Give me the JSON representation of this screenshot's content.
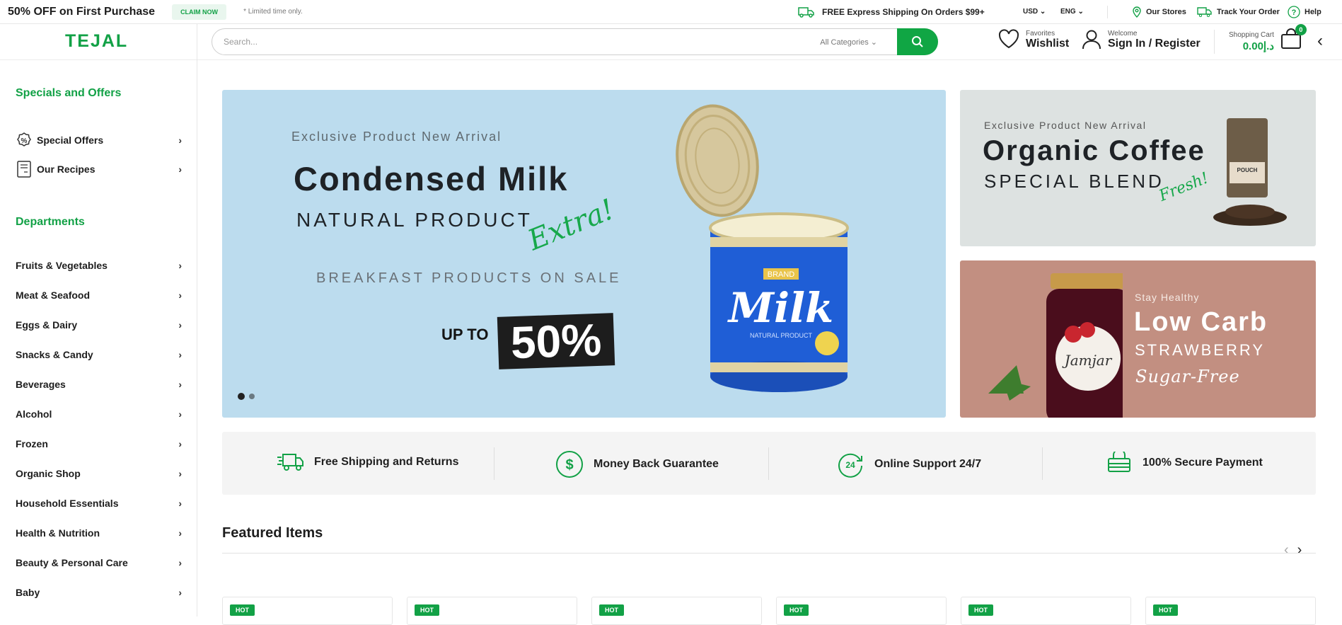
{
  "topbar": {
    "promo": "50% OFF on First Purchase",
    "claim": "CLAIM NOW",
    "limited": "* Limited time only.",
    "shipping": "FREE Express Shipping On Orders $99+",
    "currency": "USD",
    "language": "ENG",
    "stores": "Our Stores",
    "track": "Track Your Order",
    "help": "Help"
  },
  "header": {
    "logo": "TEJAL",
    "search_placeholder": "Search...",
    "categories": "All Categories",
    "favorites_small": "Favorites",
    "favorites_big": "Wishlist",
    "welcome_small": "Welcome",
    "welcome_big": "Sign In / Register",
    "cart_small": "Shopping Cart",
    "cart_total": "0.00د.إ",
    "cart_count": "0"
  },
  "sidebar": {
    "specials_title": "Specials and Offers",
    "specials": [
      "Special Offers",
      "Our Recipes"
    ],
    "departments_title": "Departments",
    "departments": [
      "Fruits & Vegetables",
      "Meat & Seafood",
      "Eggs & Dairy",
      "Snacks & Candy",
      "Beverages",
      "Alcohol",
      "Frozen",
      "Organic Shop",
      "Household Essentials",
      "Health & Nutrition",
      "Beauty & Personal Care",
      "Baby"
    ]
  },
  "banner": {
    "exclusive": "Exclusive Product New Arrival",
    "title": "Condensed Milk",
    "subtitle": "NATURAL PRODUCT",
    "extra": "Extra!",
    "sale": "BREAKFAST PRODUCTS ON SALE",
    "upto": "UP TO",
    "percent": "50%",
    "can_brand": "BRAND",
    "can_label": "Milk",
    "can_sub": "NATURAL PRODUCT"
  },
  "banner_coffee": {
    "exclusive": "Exclusive Product New Arrival",
    "title": "Organic Coffee",
    "subtitle": "SPECIAL BLEND",
    "extra": "Fresh!",
    "pouch": "POUCH"
  },
  "banner_jam": {
    "small": "Stay Healthy",
    "title": "Low Carb",
    "subtitle": "STRAWBERRY",
    "extra": "Sugar-Free",
    "label": "Jamjar"
  },
  "features": [
    "Free Shipping and Returns",
    "Money Back Guarantee",
    "Online Support 24/7",
    "100% Secure Payment"
  ],
  "featured": {
    "title": "Featured Items",
    "badge": "HOT"
  },
  "colors": {
    "accent": "#12a146",
    "banner_bg": "#bcdcee"
  }
}
